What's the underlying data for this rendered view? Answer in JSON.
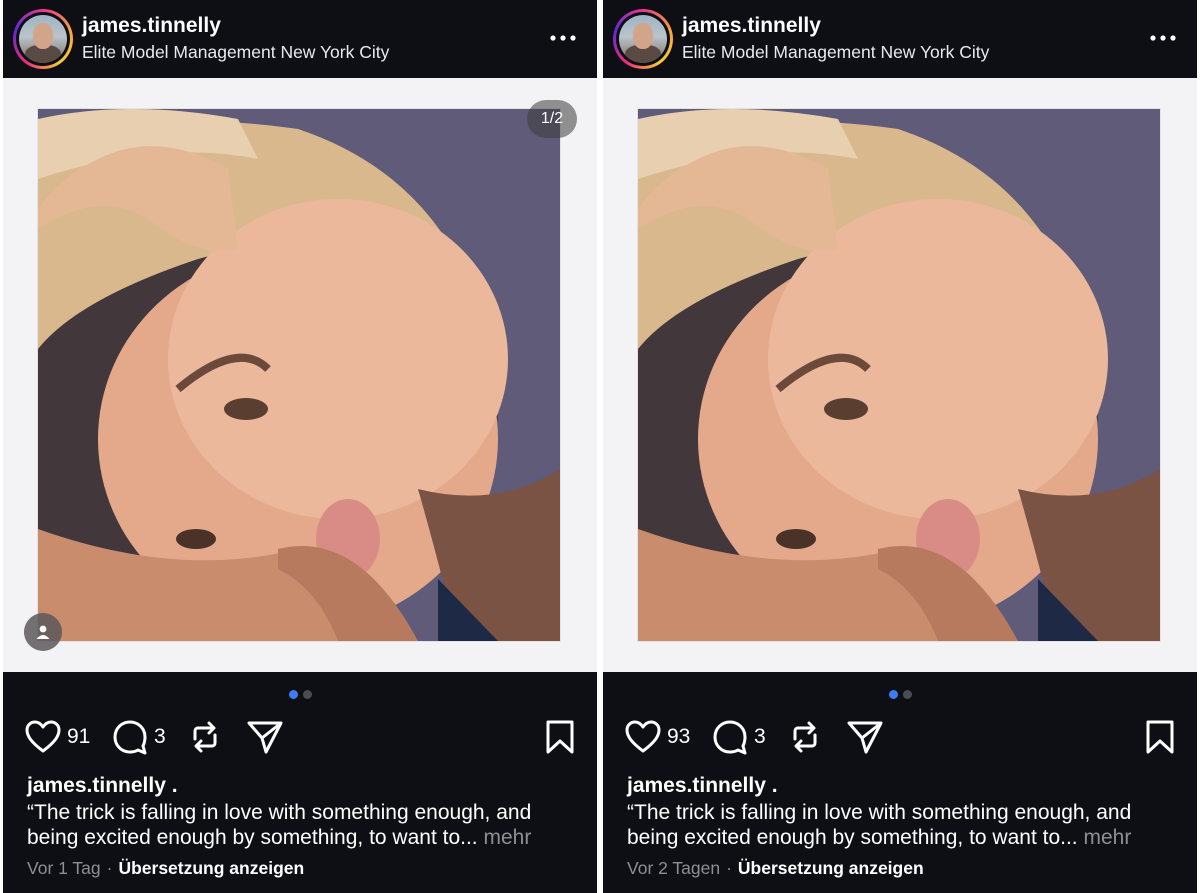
{
  "posts": [
    {
      "username": "james.tinnelly",
      "location": "Elite Model Management New York City",
      "image_counter": "1/2",
      "likes": "91",
      "comments": "3",
      "caption_user": "james.tinnelly .",
      "caption_line1": "“The trick is falling in love with something enough, and",
      "caption_line2": "being excited enough by something, to want to...",
      "more_label": "mehr",
      "time": "Vor 1 Tag",
      "separator": "·",
      "translate_label": "Übersetzung anzeigen"
    },
    {
      "username": "james.tinnelly",
      "location": "Elite Model Management New York City",
      "likes": "93",
      "comments": "3",
      "caption_user": "james.tinnelly .",
      "caption_line1": "“The trick is falling in love with something enough, and",
      "caption_line2": "being excited enough by something, to want to...",
      "more_label": "mehr",
      "time": "Vor 2 Tagen",
      "separator": "·",
      "translate_label": "Übersetzung anzeigen"
    }
  ],
  "icons": {
    "more": "more-horizontal-icon",
    "like": "heart-icon",
    "comment": "comment-bubble-icon",
    "repost": "repost-icon",
    "share": "paper-plane-icon",
    "save": "bookmark-icon",
    "tag": "user-tag-icon"
  },
  "colors": {
    "background": "#0d0f14",
    "text": "#ffffff",
    "muted": "#8e8f96",
    "active_dot": "#3d7cf4",
    "inactive_dot": "#4b4d55"
  },
  "carousel": {
    "active_index": 0,
    "count": 2
  }
}
